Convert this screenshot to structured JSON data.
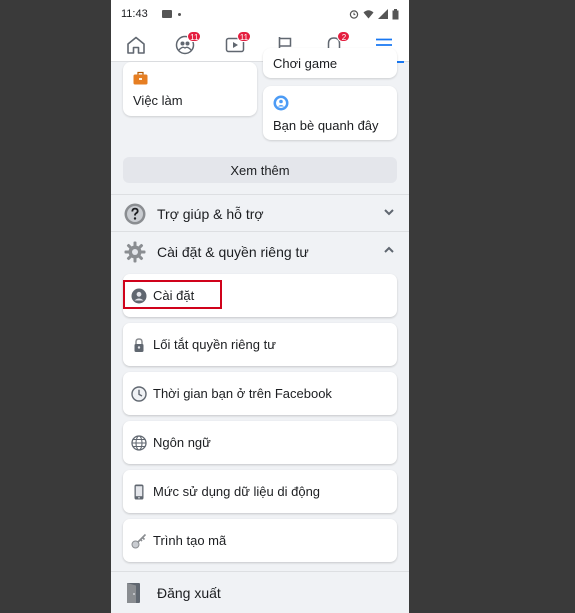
{
  "status_bar": {
    "time": "11:43"
  },
  "nav": {
    "friends_badge": "11",
    "watch_badge": "11",
    "notifications_badge": "2"
  },
  "shortcuts": {
    "jobs_label": "Việc làm",
    "games_label": "Chơi game",
    "nearby_label": "Bạn bè quanh đây"
  },
  "see_more_label": "Xem thêm",
  "sections": {
    "help_label": "Trợ giúp & hỗ trợ",
    "settings_privacy_label": "Cài đặt & quyền riêng tư"
  },
  "menu": [
    {
      "label": "Cài đặt",
      "icon": "user-gear-icon"
    },
    {
      "label": "Lối tắt quyền riêng tư",
      "icon": "lock-icon"
    },
    {
      "label": "Thời gian bạn ở trên Facebook",
      "icon": "clock-icon"
    },
    {
      "label": "Ngôn ngữ",
      "icon": "globe-icon"
    },
    {
      "label": "Mức sử dụng dữ liệu di động",
      "icon": "phone-icon"
    },
    {
      "label": "Trình tạo mã",
      "icon": "key-icon"
    }
  ],
  "logout_label": "Đăng xuất",
  "colors": {
    "accent": "#1877f2",
    "badge": "#e41e3f",
    "highlight": "#d0021b",
    "background": "#f0f2f5"
  }
}
